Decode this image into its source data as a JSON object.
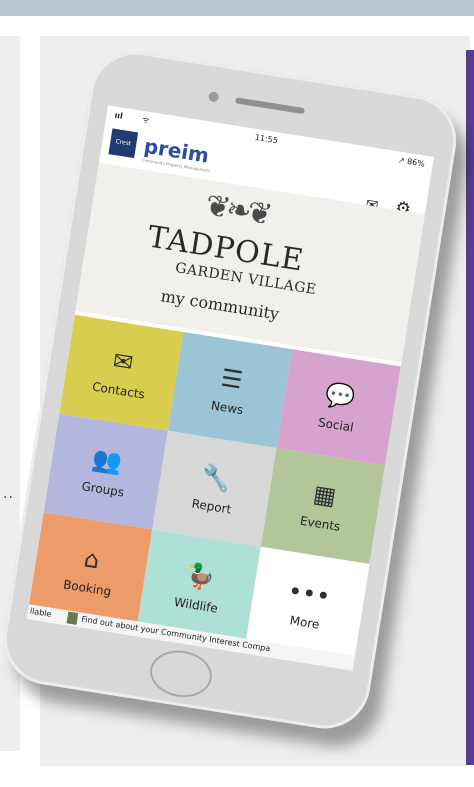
{
  "background": {
    "left_dots": "..",
    "colors": {
      "topbar": "#b8c6cf",
      "panel": "#eeeeee",
      "purple": "#5b3b8c"
    }
  },
  "phone": {
    "status": {
      "signal": "ııl",
      "wifi": "ᯤ",
      "time": "11:55",
      "battery": "↗ 86%"
    },
    "header": {
      "brand_logo_text": "Crest",
      "brand": "preim",
      "brand_tagline": "Community Property Management"
    },
    "hero": {
      "title": "TADPOLE",
      "subtitle": "GARDEN VILLAGE",
      "tagline": "my community"
    },
    "tiles": [
      {
        "label": "Contacts",
        "icon": "envelope-icon",
        "color": "#d9cd4f"
      },
      {
        "label": "News",
        "icon": "list-icon",
        "color": "#9bc5d6"
      },
      {
        "label": "Social",
        "icon": "chat-icon",
        "color": "#d6a3cf"
      },
      {
        "label": "Groups",
        "icon": "people-icon",
        "color": "#b3b7de"
      },
      {
        "label": "Report",
        "icon": "wrench-icon",
        "color": "#d7d7d7"
      },
      {
        "label": "Events",
        "icon": "calendar-icon",
        "color": "#b2c69a"
      },
      {
        "label": "Booking",
        "icon": "home-icon",
        "color": "#ee9b6a"
      },
      {
        "label": "Wildlife",
        "icon": "duck-icon",
        "color": "#aee0d6"
      },
      {
        "label": "More",
        "icon": "dots-icon",
        "color": "#ffffff"
      }
    ],
    "ticker": {
      "left": "ilable",
      "text": "Find out about your Community Interest Compa"
    }
  }
}
